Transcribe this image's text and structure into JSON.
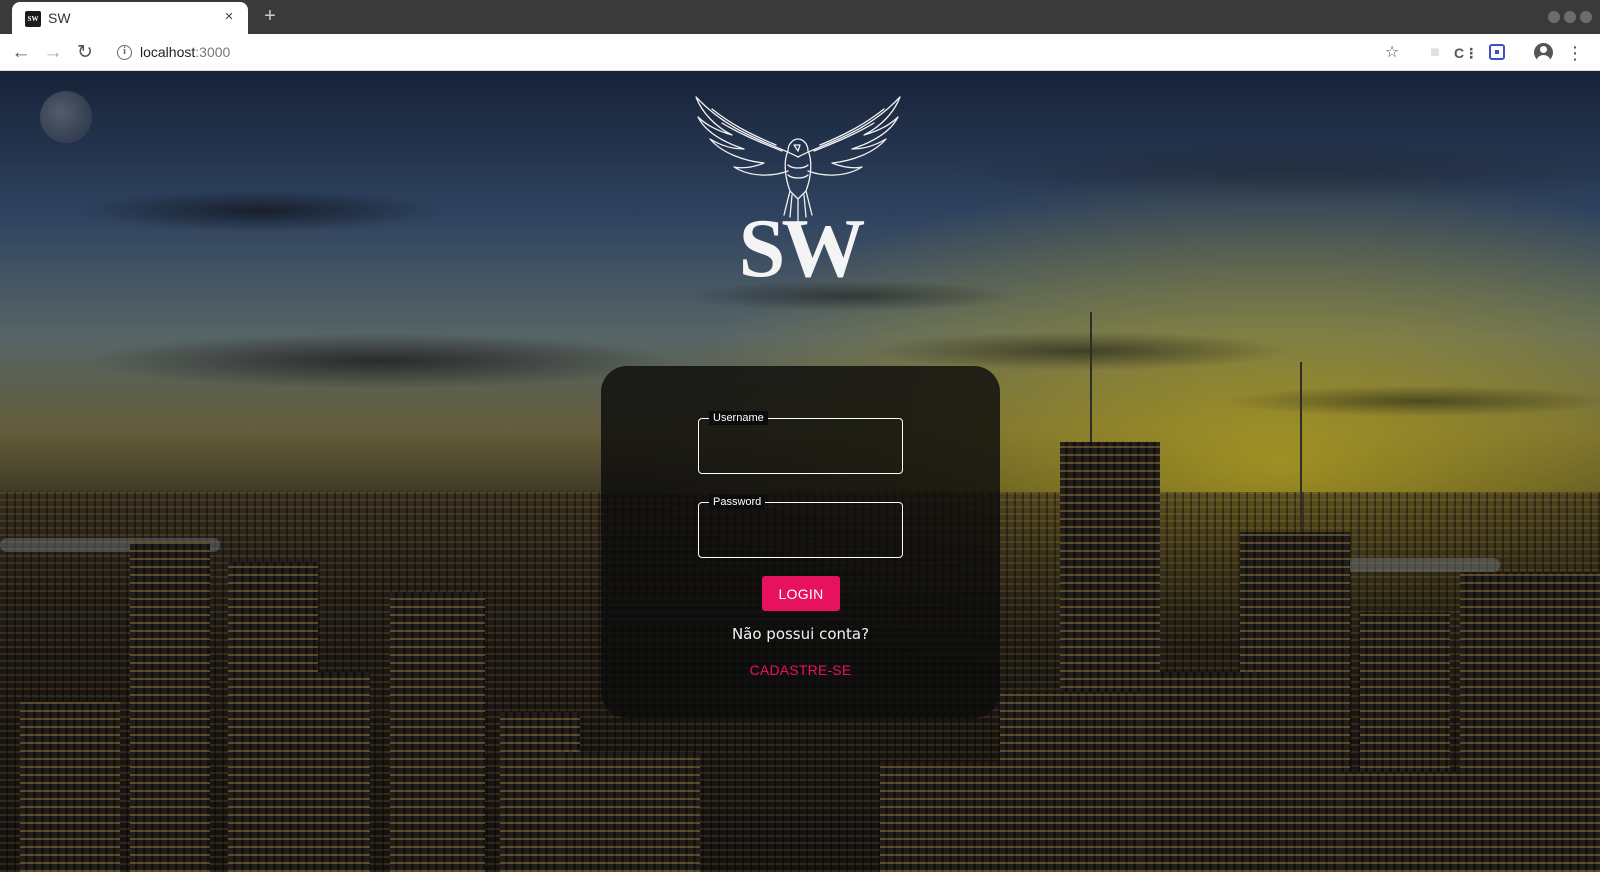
{
  "browser": {
    "tab_title": "SW",
    "tab_favicon_text": "SW",
    "tab_close": "×",
    "new_tab": "+",
    "url_host": "localhost",
    "url_port": ":3000",
    "icons": {
      "back": "back-arrow-icon",
      "forward": "forward-arrow-icon",
      "reload": "reload-icon",
      "site_info": "info-icon",
      "bookmark": "star-icon",
      "extension_1": "extension-icon",
      "extension_2": "cast-icon",
      "extension_3": "screen-capture-icon",
      "profile": "account-circle-icon",
      "menu": "kebab-menu-icon"
    }
  },
  "page": {
    "logo": {
      "text": "SW",
      "emblem": "eagle-icon",
      "color": "#f4f4f4"
    },
    "form": {
      "username_label": "Username",
      "username_value": "",
      "password_label": "Password",
      "password_value": "",
      "login_button": "LOGIN",
      "no_account_text": "Não possui conta?",
      "signup_link": "CADASTRE-SE"
    },
    "colors": {
      "accent": "#e6125d",
      "card_background": "#0c0c0c",
      "text": "#ffffff"
    }
  }
}
